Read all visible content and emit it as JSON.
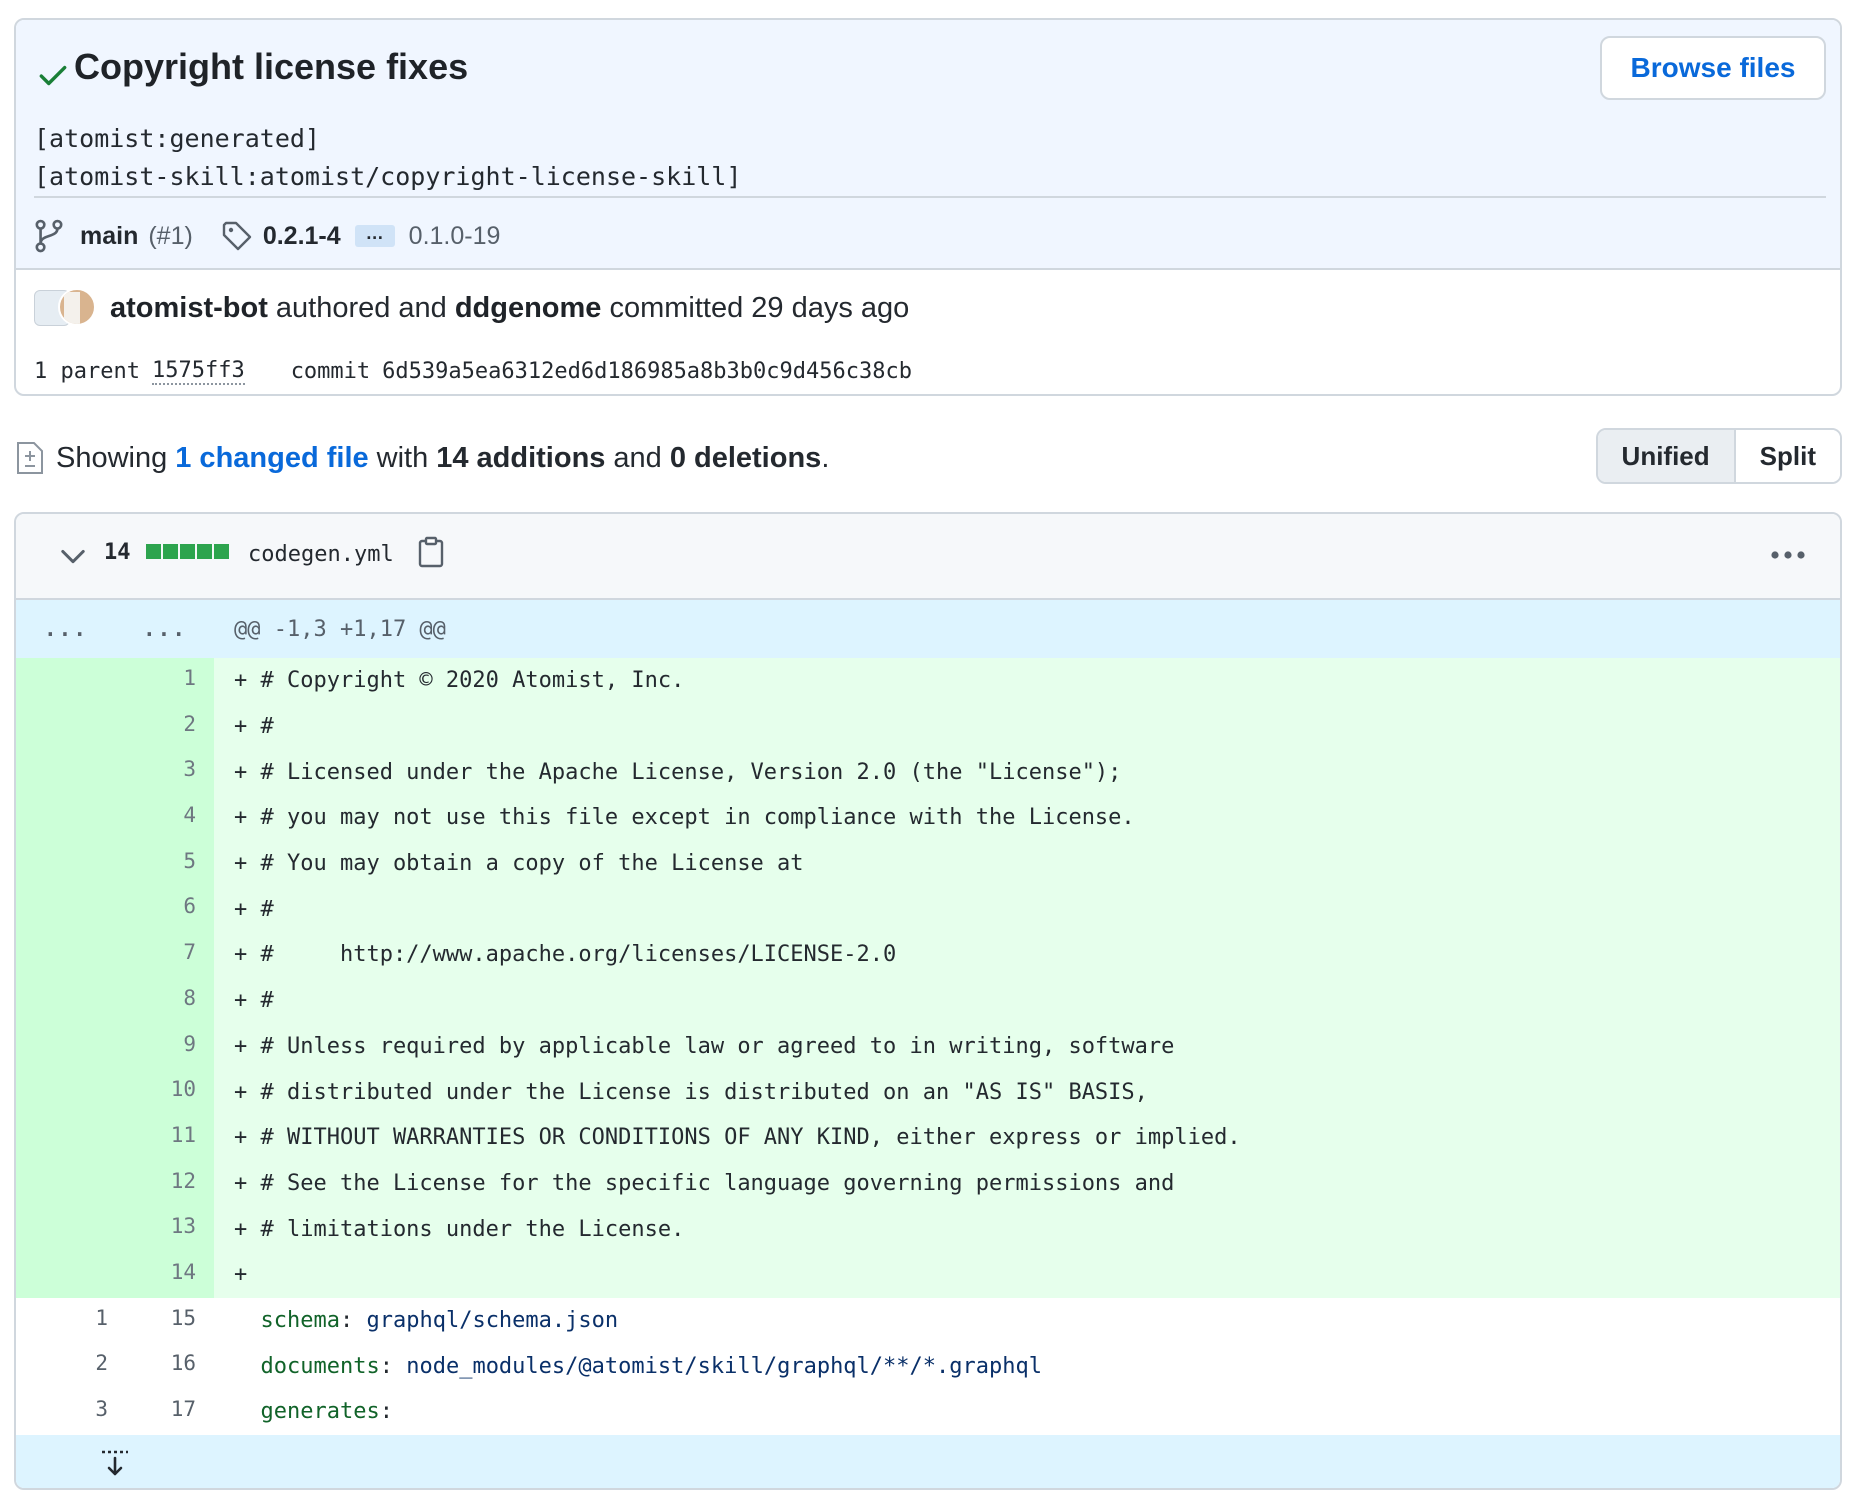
{
  "commit": {
    "title": "Copyright license fixes",
    "description_lines": [
      "[atomist:generated]",
      "[atomist-skill:atomist/copyright-license-skill]"
    ],
    "browse_label": "Browse files",
    "branch": "main",
    "pr_ref": "(#1)",
    "tag_first": "0.2.1-4",
    "tag_ellipsis": "…",
    "tag_last": "0.1.0-19",
    "author": "atomist-bot",
    "authored_text": "authored and",
    "committer": "ddgenome",
    "committed_text": "committed 29 days ago",
    "parent_label": "1 parent",
    "parent_sha": "1575ff3",
    "commit_label": "commit",
    "commit_sha": "6d539a5ea6312ed6d186985a8b3b0c9d456c38cb"
  },
  "summary": {
    "showing": "Showing",
    "changed_link": "1 changed file",
    "with": "with",
    "additions": "14 additions",
    "and": "and",
    "deletions": "0 deletions",
    "period": ".",
    "view_unified": "Unified",
    "view_split": "Split"
  },
  "file": {
    "count": "14",
    "name": "codegen.yml",
    "hunk_old": "...",
    "hunk_new": "...",
    "hunk_header": "@@ -1,3 +1,17 @@",
    "additions": [
      {
        "num": "1",
        "code": "+ # Copyright © 2020 Atomist, Inc."
      },
      {
        "num": "2",
        "code": "+ #"
      },
      {
        "num": "3",
        "code": "+ # Licensed under the Apache License, Version 2.0 (the \"License\");"
      },
      {
        "num": "4",
        "code": "+ # you may not use this file except in compliance with the License."
      },
      {
        "num": "5",
        "code": "+ # You may obtain a copy of the License at"
      },
      {
        "num": "6",
        "code": "+ #"
      },
      {
        "num": "7",
        "code": "+ #     http://www.apache.org/licenses/LICENSE-2.0"
      },
      {
        "num": "8",
        "code": "+ #"
      },
      {
        "num": "9",
        "code": "+ # Unless required by applicable law or agreed to in writing, software"
      },
      {
        "num": "10",
        "code": "+ # distributed under the License is distributed on an \"AS IS\" BASIS,"
      },
      {
        "num": "11",
        "code": "+ # WITHOUT WARRANTIES OR CONDITIONS OF ANY KIND, either express or implied."
      },
      {
        "num": "12",
        "code": "+ # See the License for the specific language governing permissions and"
      },
      {
        "num": "13",
        "code": "+ # limitations under the License."
      },
      {
        "num": "14",
        "code": "+"
      }
    ],
    "context": [
      {
        "old": "1",
        "new": "15",
        "key": "schema",
        "sep": ": ",
        "val": "graphql/schema.json"
      },
      {
        "old": "2",
        "new": "16",
        "key": "documents",
        "sep": ": ",
        "val": "node_modules/@atomist/skill/graphql/**/*.graphql"
      },
      {
        "old": "3",
        "new": "17",
        "key": "generates",
        "sep": ":",
        "val": ""
      }
    ]
  },
  "colors": {
    "link": "#0969da",
    "addition_bg": "#e6ffec",
    "addition_num_bg": "#ccffd8",
    "hunk_bg": "#ddf4ff",
    "commit_header_bg": "#f0f6ff",
    "diffstat_green": "#2da44e"
  }
}
